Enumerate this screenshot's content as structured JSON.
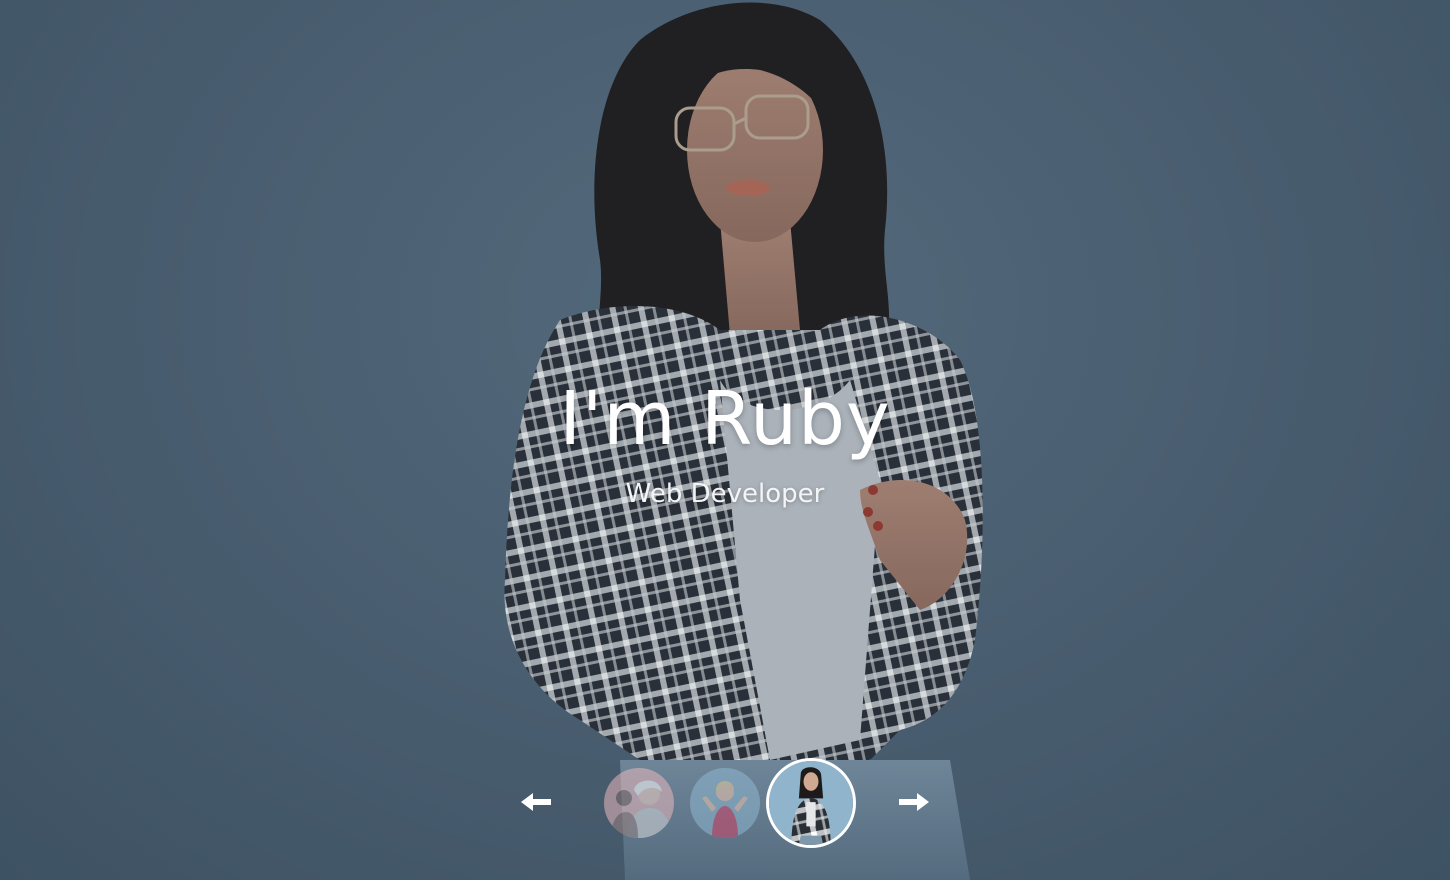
{
  "hero": {
    "title": "I'm Ruby",
    "subtitle": "Web Developer"
  },
  "carousel": {
    "prev_icon": "arrow-left-icon",
    "next_icon": "arrow-right-icon",
    "thumbnails": [
      {
        "icon": "person-thumbnail-pink",
        "active": false
      },
      {
        "icon": "person-thumbnail-blue",
        "active": false
      },
      {
        "icon": "person-thumbnail-plaid",
        "active": true
      }
    ]
  },
  "colors": {
    "background": "#52687a",
    "text": "#ffffff",
    "active_border": "#ffffff"
  }
}
